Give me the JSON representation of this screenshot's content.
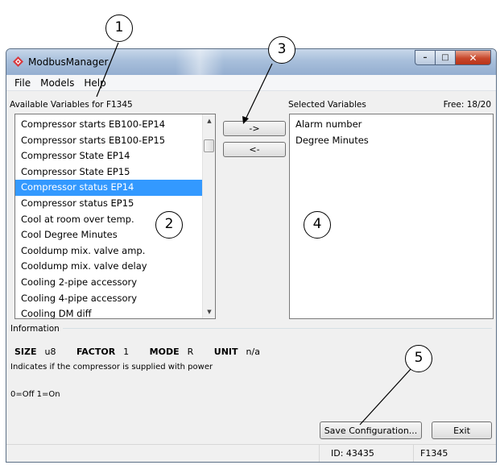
{
  "window": {
    "title": "ModbusManager",
    "controls": {
      "minimize": "–",
      "maximize": "□",
      "close": "✕"
    }
  },
  "menu": {
    "items": [
      "File",
      "Models",
      "Help"
    ]
  },
  "available": {
    "label": "Available Variables for F1345",
    "items": [
      "Compressor starts EB100-EP14",
      "Compressor starts EB100-EP15",
      "Compressor State EP14",
      "Compressor State EP15",
      "Compressor status EP14",
      "Compressor status EP15",
      "Cool at room over temp.",
      "Cool Degree Minutes",
      "Cooldump mix. valve amp.",
      "Cooldump mix. valve delay",
      "Cooling 2-pipe accessory",
      "Cooling 4-pipe accessory",
      "Cooling DM diff"
    ],
    "selected_item": "Compressor status EP14"
  },
  "transfer": {
    "add_label": "->",
    "remove_label": "<-"
  },
  "selected": {
    "label": "Selected Variables",
    "free": "Free: 18/20",
    "items": [
      "Alarm number",
      "Degree Minutes"
    ]
  },
  "info": {
    "legend": "Information",
    "size_label": "SIZE",
    "size_value": "u8",
    "factor_label": "FACTOR",
    "factor_value": "1",
    "mode_label": "MODE",
    "mode_value": "R",
    "unit_label": "UNIT",
    "unit_value": "n/a",
    "description": "Indicates if the compressor is supplied with power",
    "values": "0=Off 1=On"
  },
  "actions": {
    "save_label": "Save Configuration...",
    "exit_label": "Exit"
  },
  "status": {
    "id": "ID: 43435",
    "model": "F1345"
  },
  "callouts": [
    "1",
    "2",
    "3",
    "4",
    "5"
  ],
  "colors": {
    "selection": "#3399ff",
    "close_button": "#c8472b",
    "icon": "#d9393e"
  }
}
